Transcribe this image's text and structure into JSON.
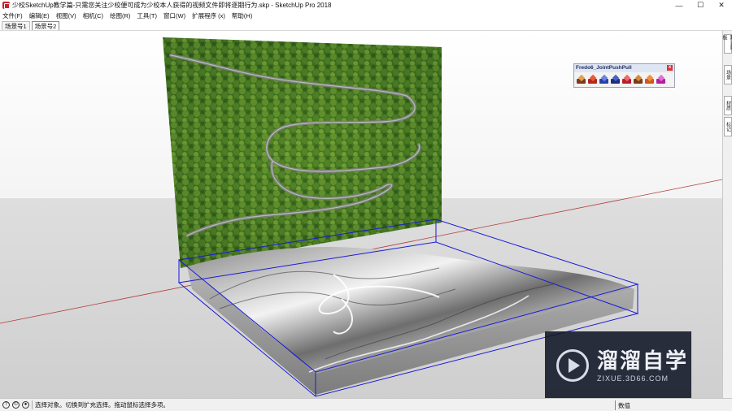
{
  "window": {
    "title": "少校SketchUp教学篇-只需您关注少校便可成为少校本人获得的视频文件即将逐期行为.skp - SketchUp Pro 2018",
    "minimize": "—",
    "maximize": "☐",
    "close": "✕"
  },
  "menu": {
    "items": [
      "文件(F)",
      "编辑(E)",
      "视图(V)",
      "相机(C)",
      "绘图(R)",
      "工具(T)",
      "窗口(W)",
      "扩展程序 (x)",
      "帮助(H)"
    ]
  },
  "scenes": {
    "tabs": [
      "场景号1",
      "场景号2"
    ],
    "active_index": 1
  },
  "toolbar_fredo": {
    "title": "Fredo6_JointPushPull",
    "close": "x",
    "icon_colors": [
      "#7a3b1a",
      "#b0281f",
      "#2940a8",
      "#1e2f80",
      "#b71f2a",
      "#7a3b1a",
      "#d2551d",
      "#b01fa0"
    ]
  },
  "right_tray": {
    "tabs": [
      "默认面板",
      "场景",
      "材质",
      "标记"
    ]
  },
  "status": {
    "message": "选择对象。切换到扩充选择。拖动鼠标选择多项。",
    "measurements_label": "数值"
  },
  "watermark": {
    "title": "溜溜自学",
    "url": "ZIXUE.3D66.COM"
  },
  "colors": {
    "selection": "#1a1ad8",
    "axis_red": "#b33a3a",
    "sky": "#ffffff",
    "ground": "#d9d9d9"
  }
}
